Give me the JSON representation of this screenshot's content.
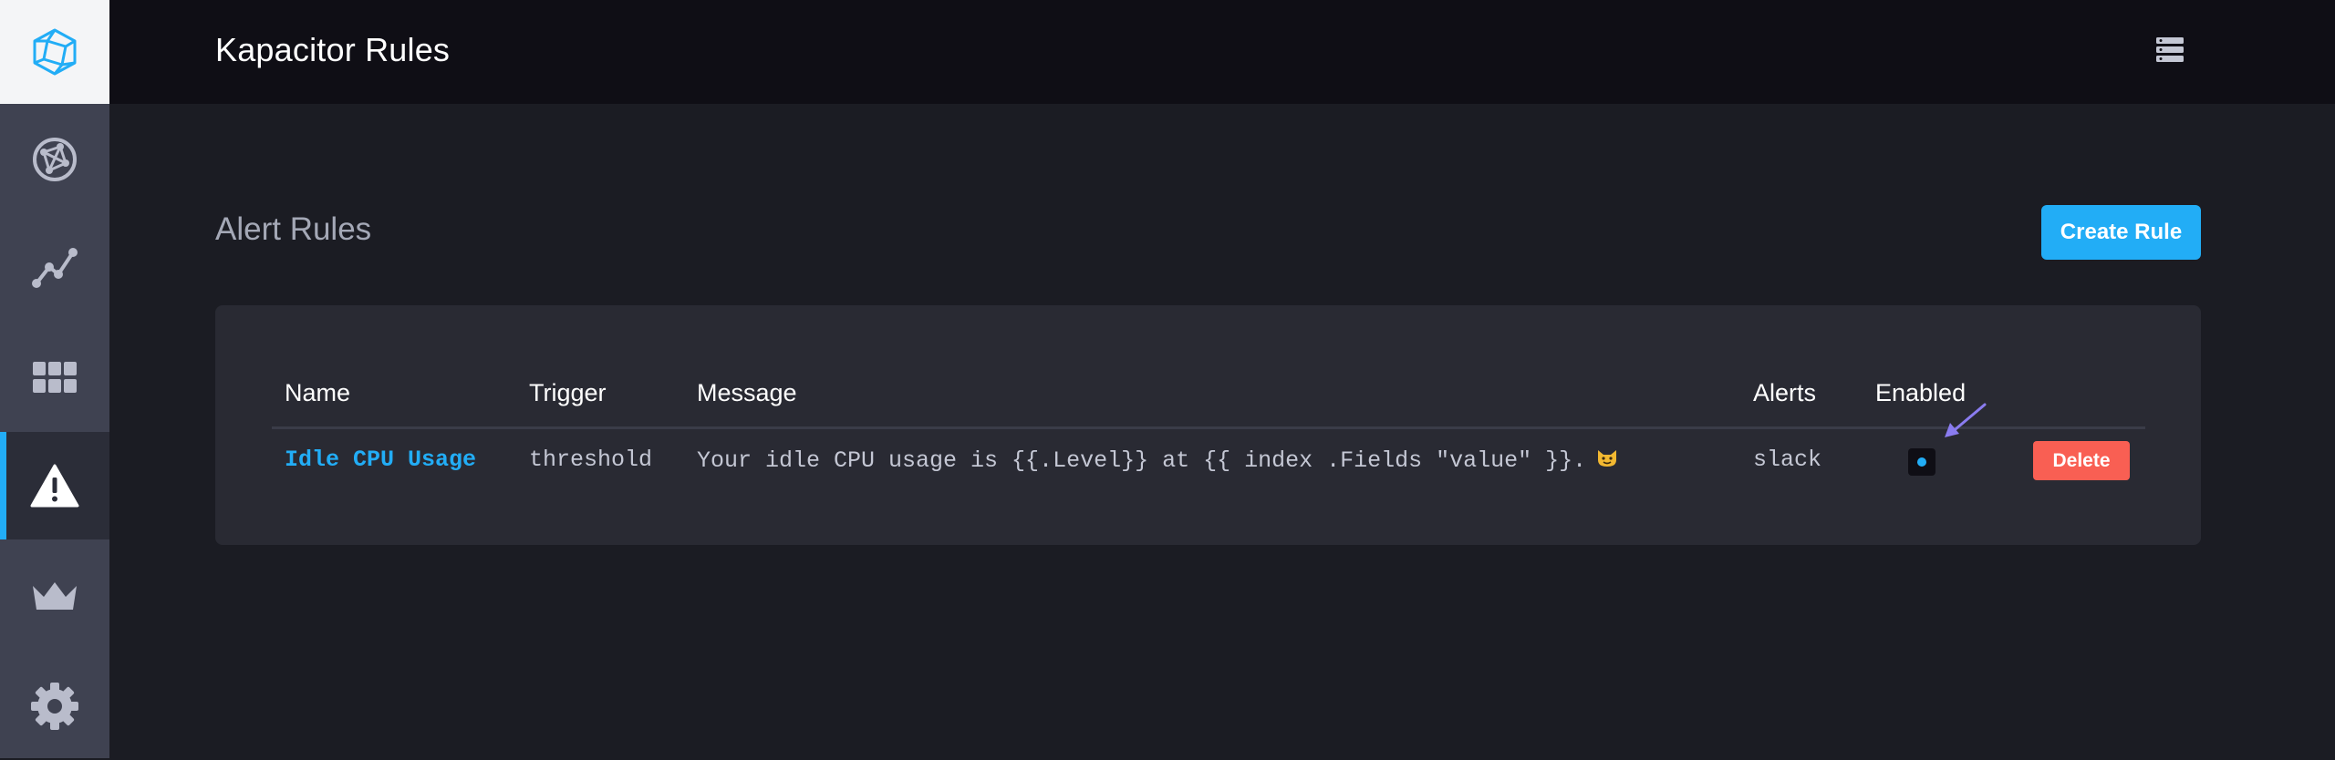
{
  "app": {
    "page_title": "Kapacitor Rules"
  },
  "sidebar": {
    "logo_icon": "chronograf-logo-icon",
    "items": [
      {
        "icon": "graph-network-icon",
        "active": false
      },
      {
        "icon": "data-explorer-icon",
        "active": false
      },
      {
        "icon": "dashboards-grid-icon",
        "active": false
      },
      {
        "icon": "alert-triangle-icon",
        "active": true
      },
      {
        "icon": "crown-icon",
        "active": false
      },
      {
        "icon": "gear-icon",
        "active": false
      }
    ]
  },
  "topbar": {
    "source_icon": "server-stack-icon"
  },
  "main": {
    "section_title": "Alert Rules",
    "create_button_label": "Create Rule",
    "table": {
      "columns": [
        "Name",
        "Trigger",
        "Message",
        "Alerts",
        "Enabled"
      ],
      "rows": [
        {
          "name": "Idle CPU Usage",
          "trigger": "threshold",
          "message": "Your idle CPU usage is {{.Level}} at {{ index .Fields \"value\" }}.",
          "message_emoji": "smiling-cat-emoji",
          "alerts": "slack",
          "enabled": true,
          "delete_label": "Delete"
        }
      ]
    }
  },
  "colors": {
    "accent": "#22adf6",
    "danger": "#f95f53",
    "annotation_arrow": "#8a7cf0"
  }
}
